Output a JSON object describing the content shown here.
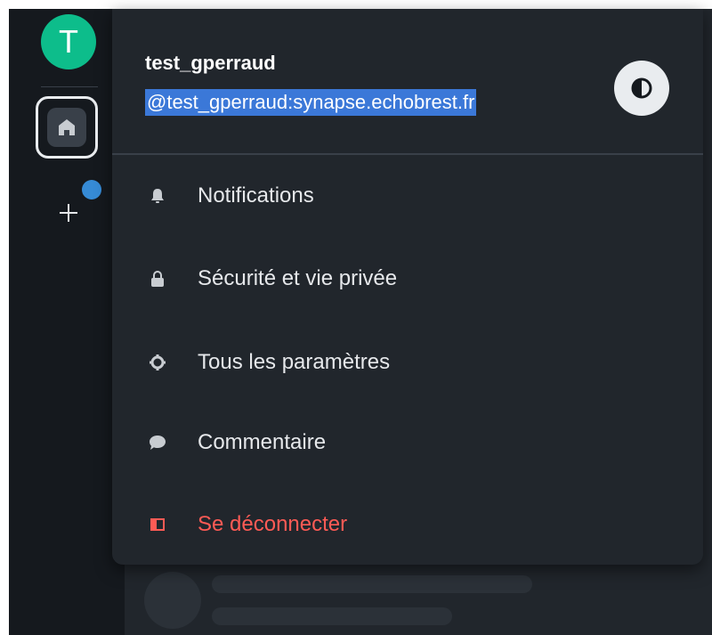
{
  "space_bar": {
    "avatar_initial": "T",
    "home_icon": "home-icon",
    "add_icon": "plus-icon"
  },
  "user_menu": {
    "display_name": "test_gperraud",
    "user_id": "@test_gperraud:synapse.echobrest.fr",
    "theme_toggle_icon": "contrast-icon",
    "items": [
      {
        "label": "Notifications",
        "icon": "bell-icon"
      },
      {
        "label": "Sécurité et vie privée",
        "icon": "lock-icon"
      },
      {
        "label": "Tous les paramètres",
        "icon": "gear-icon"
      },
      {
        "label": "Commentaire",
        "icon": "chat-bubble-icon"
      },
      {
        "label": "Se déconnecter",
        "icon": "sign-out-icon"
      }
    ]
  },
  "colors": {
    "accent_green": "#0dbd8b",
    "notification_blue": "#368bd6",
    "selection_blue": "#3b78d8",
    "danger_red": "#ff5b55",
    "background": "#15191e",
    "menu_background": "#21262c"
  }
}
